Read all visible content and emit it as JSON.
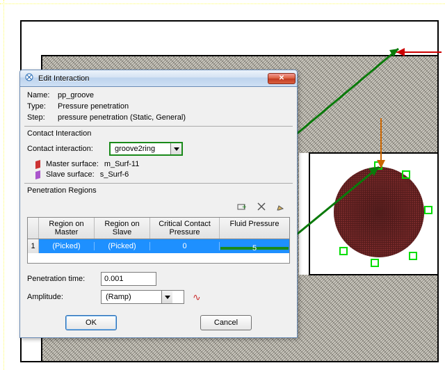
{
  "dialog": {
    "title": "Edit Interaction",
    "fields": {
      "name_label": "Name:",
      "name_value": "pp_groove",
      "type_label": "Type:",
      "type_value": "Pressure penetration",
      "step_label": "Step:",
      "step_value": "pressure penetration (Static, General)"
    },
    "contact_interaction": {
      "section_title": "Contact Interaction",
      "label": "Contact interaction:",
      "value": "groove2ring",
      "master_label": "Master surface:",
      "master_value": "m_Surf-11",
      "master_color": "#cc3333",
      "slave_label": "Slave surface:",
      "slave_value": "s_Surf-6",
      "slave_color": "#aa55cc"
    },
    "penetration_regions": {
      "section_title": "Penetration Regions",
      "headers": {
        "c1": "Region on Master",
        "c2": "Region on Slave",
        "c3": "Critical Contact Pressure",
        "c4": "Fluid Pressure"
      },
      "row": {
        "idx": "1",
        "c1": "(Picked)",
        "c2": "(Picked)",
        "c3": "0",
        "c4": "5"
      }
    },
    "penetration_time": {
      "label": "Penetration time:",
      "value": "0.001"
    },
    "amplitude": {
      "label": "Amplitude:",
      "value": "(Ramp)"
    },
    "buttons": {
      "ok": "OK",
      "cancel": "Cancel"
    }
  }
}
